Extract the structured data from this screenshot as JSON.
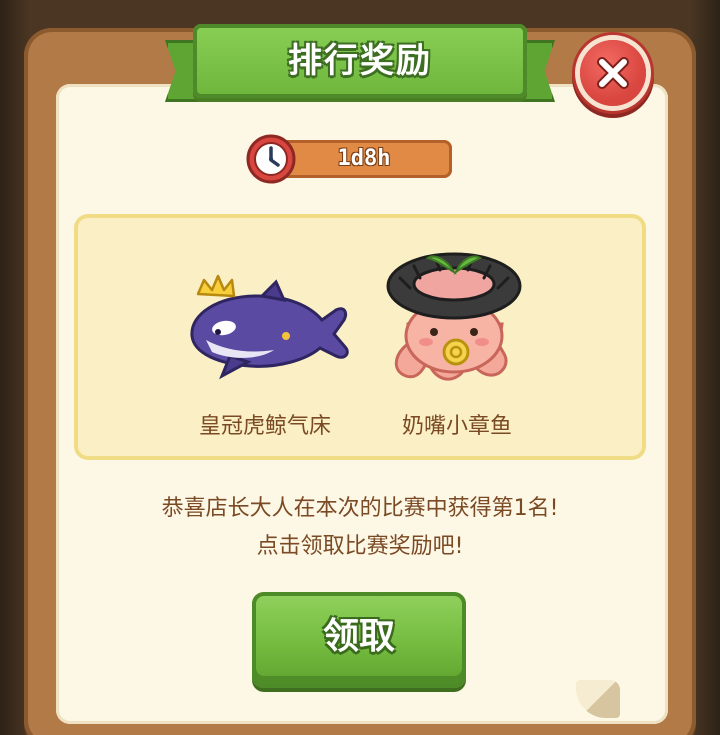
{
  "dialog": {
    "title": "排行奖励",
    "close_icon": "close-icon"
  },
  "timer": {
    "icon": "clock-icon",
    "remaining": "1d8h"
  },
  "rewards": [
    {
      "name": "皇冠虎鲸气床",
      "icon": "crowned-orca-float-icon"
    },
    {
      "name": "奶嘴小章鱼",
      "icon": "pacifier-octopus-icon"
    }
  ],
  "message": {
    "line1": "恭喜店长大人在本次的比赛中获得第1名!",
    "line2": "点击领取比赛奖励吧!"
  },
  "claim_button": {
    "label": "领取"
  },
  "colors": {
    "panel_frame": "#b27a47",
    "panel_bg": "#fdf7e6",
    "ribbon_green": "#7cc449",
    "close_red": "#d9453f",
    "timer_orange": "#e08a45",
    "rewards_bg": "#fbf0c5",
    "text_brown": "#7a4a24"
  }
}
